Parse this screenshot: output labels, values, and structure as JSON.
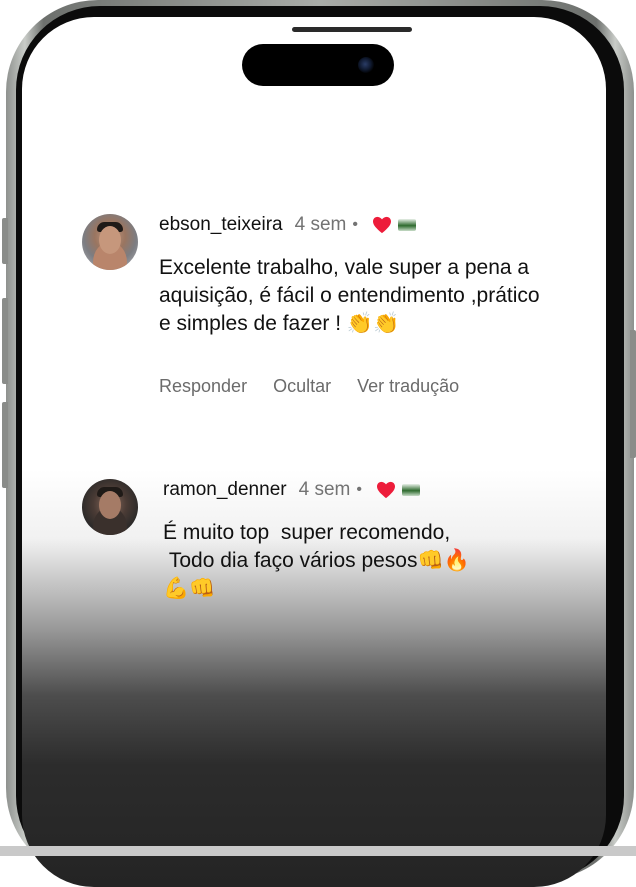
{
  "comments": [
    {
      "username": "ebson_teixeira",
      "time": "4 sem",
      "separator": "•",
      "text": "Excelente trabalho, vale super a pena a aquisição, é fácil o entendimento ,prático e simples de fazer ! 👏👏",
      "heart_icon": "heart-icon",
      "actions": {
        "reply": "Responder",
        "hide": "Ocultar",
        "translate": "Ver tradução"
      }
    },
    {
      "username": "ramon_denner",
      "time": "4 sem",
      "separator": "•",
      "text": "É muito top  super recomendo,\n Todo dia faço vários pesos👊🔥\n💪👊",
      "heart_icon": "heart-icon"
    }
  ],
  "colors": {
    "heart": "#ed1c3a",
    "text": "#111111",
    "secondary": "#737373"
  }
}
